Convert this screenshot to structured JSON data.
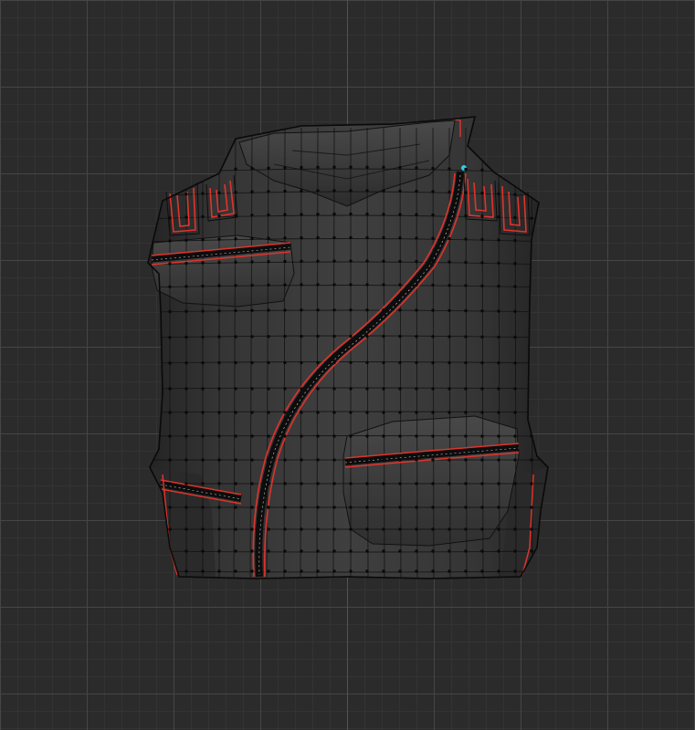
{
  "viewport": {
    "mode": "front-orthographic",
    "background_color": "#2b2b2b",
    "grid_color": "#464646",
    "axis_color": "#4b46a8"
  },
  "model": {
    "object": "tactical vest",
    "mesh_color": "#3a3a3a",
    "wire_color": "#101010",
    "seam_color": "#e0332b",
    "selection_marker_color": "#2ad1e6",
    "vertices_shown": true
  }
}
